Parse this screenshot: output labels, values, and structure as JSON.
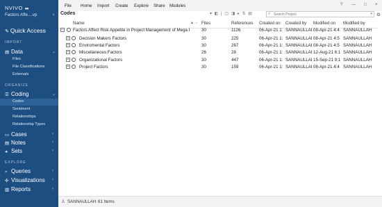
{
  "app": {
    "logo": "NVIVO",
    "logo_dots": "●●",
    "project": "Factors Affe....vp",
    "collapse_icon": "‹"
  },
  "sidebar": {
    "quick_access": "Quick Access",
    "sections": {
      "import": "IMPORT",
      "organize": "ORGANIZE",
      "explore": "EXPLORE"
    },
    "data": {
      "label": "Data",
      "items": [
        "Files",
        "File Classifications",
        "Externals"
      ]
    },
    "coding": {
      "label": "Coding",
      "items": [
        "Codes",
        "Sentiment",
        "Relationships",
        "Relationship Types"
      ]
    },
    "cases": "Cases",
    "notes": "Notes",
    "sets": "Sets",
    "queries": "Queries",
    "visualizations": "Visualizations",
    "reports": "Reports"
  },
  "menu": {
    "items": [
      "File",
      "Home",
      "Import",
      "Create",
      "Explore",
      "Share",
      "Modules"
    ],
    "window_controls": [
      "?",
      "—",
      "□",
      "×"
    ]
  },
  "toolbar": {
    "title": "Codes",
    "icons": "▾ ◧ | ◫ ◨ ▸ ⇅ ▤",
    "search_placeholder": "Search Project",
    "settings_icon": "⚙"
  },
  "table": {
    "columns": {
      "name": "Name",
      "sort_icon": "▲ ⇔",
      "files": "Files",
      "references": "References",
      "created_on": "Created on",
      "created_by": "Created by",
      "modified_on": "Modified on",
      "modified_by": "Modified by"
    },
    "rows": [
      {
        "expander": "⊟",
        "name": "Factors Affect Risk Appetite in Project Management of Mega Projec",
        "files": "30",
        "references": "1126",
        "created_on": "06-Apr-21 1:",
        "created_by": "SANNAULLAH",
        "modified_on": "08-Apr-21 4:4",
        "modified_by": "SANNAULLAH",
        "level": 0
      },
      {
        "expander": "⊞",
        "name": "Decision Makers Factors",
        "files": "30",
        "references": "225",
        "created_on": "06-Apr-21 1:",
        "created_by": "SANNAULLAH",
        "modified_on": "08-Apr-21 4:5",
        "modified_by": "SANNAULLAH",
        "level": 1
      },
      {
        "expander": "⊞",
        "name": "Enviromental Factors",
        "files": "30",
        "references": "267",
        "created_on": "06-Apr-21 1:",
        "created_by": "SANNAULLAH",
        "modified_on": "08-Apr-21 4:5",
        "modified_by": "SANNAULLAH",
        "level": 1
      },
      {
        "expander": "⊞",
        "name": "Miscellaneous Factors",
        "files": "26",
        "references": "28",
        "created_on": "06-Apr-21 1:",
        "created_by": "SANNAULLAH",
        "modified_on": "12-Aug-21 6:1",
        "modified_by": "SANNAULLAH",
        "level": 1
      },
      {
        "expander": "⊞",
        "name": "Organizational Factors",
        "files": "30",
        "references": "447",
        "created_on": "06-Apr-21 1:",
        "created_by": "SANNAULLAH",
        "modified_on": "15-Sep-21 9:1",
        "modified_by": "SANNAULLAH",
        "level": 1
      },
      {
        "expander": "⊞",
        "name": "Project Factors",
        "files": "30",
        "references": "159",
        "created_on": "06-Apr-21 1:",
        "created_by": "SANNAULLAH",
        "modified_on": "08-Apr-21 4:4",
        "modified_by": "SANNAULLAH",
        "level": 1
      }
    ]
  },
  "status": {
    "user_icon": "♙",
    "user": "SANNAULLAH",
    "count": "61 Items"
  },
  "colors": {
    "sidebar": "#1d4e82",
    "sidebar_active": "#2d6299",
    "menubar": "#f3f3f3"
  }
}
